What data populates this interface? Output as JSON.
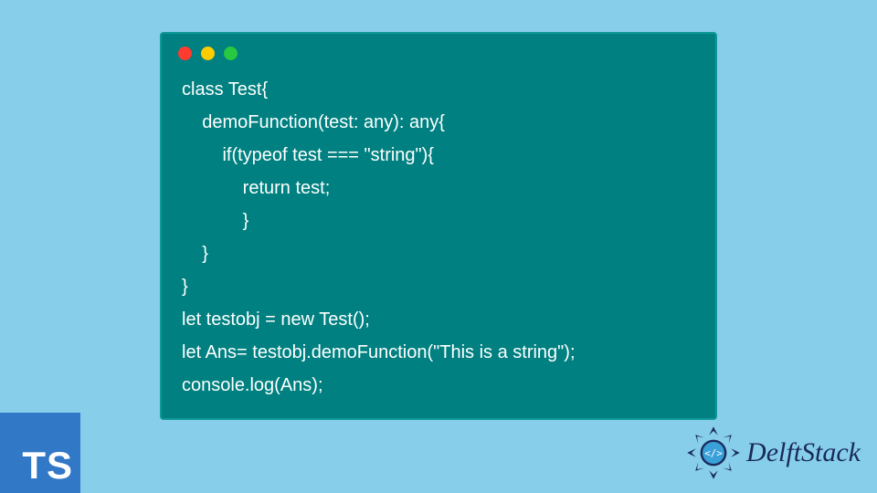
{
  "code": {
    "lines": [
      "class Test{",
      "    demoFunction(test: any): any{",
      "        if(typeof test === \"string\"){",
      "            return test;",
      "            }",
      "    }",
      "}",
      "let testobj = new Test();",
      "let Ans= testobj.demoFunction(\"This is a string\");",
      "console.log(Ans);"
    ]
  },
  "window": {
    "bg_color": "#008080",
    "dot_colors": [
      "#ff3b30",
      "#ffcc00",
      "#28c840"
    ]
  },
  "badges": {
    "ts_label": "TS",
    "delft_label": "DelftStack"
  },
  "page": {
    "bg_color": "#87ceeb"
  }
}
